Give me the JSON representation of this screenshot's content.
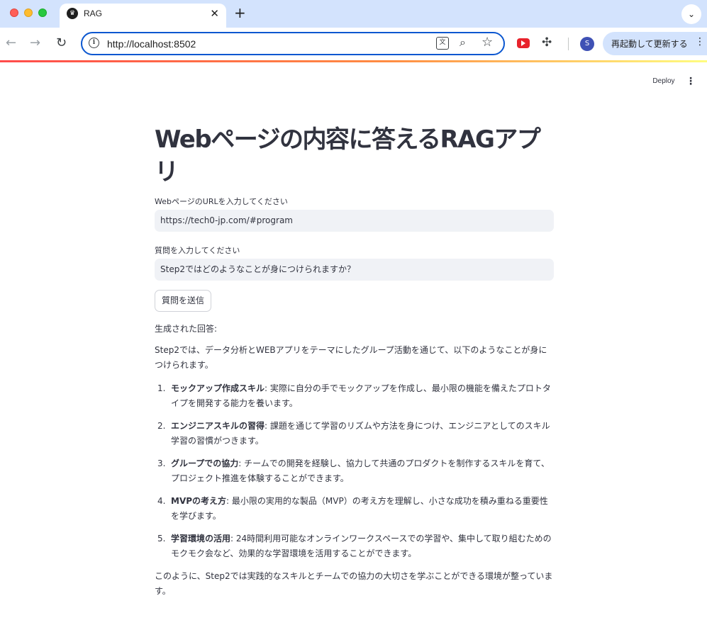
{
  "browser": {
    "tab_title": "RAG",
    "tab_close": "✕",
    "new_tab": "+",
    "url": "http://localhost:8502",
    "relaunch_label": "再起動して更新する",
    "profile_initial": "S",
    "icons": [
      "back-icon",
      "forward-icon",
      "reload-icon",
      "info-icon",
      "translate-icon",
      "zoom-icon",
      "star-icon",
      "youtube-extension-icon",
      "extensions-icon",
      "more-icon"
    ]
  },
  "app": {
    "deploy_label": "Deploy",
    "title": "Webページの内容に答えるRAGアプリ",
    "url_input": {
      "label": "WebページのURLを入力してください",
      "value": "https://tech0-jp.com/#program"
    },
    "question_input": {
      "label": "質問を入力してください",
      "value": "Step2ではどのようなことが身につけられますか？"
    },
    "submit_label": "質問を送信",
    "generated_heading": "生成された回答:",
    "answer": {
      "intro": "Step2では、データ分析とWEBアプリをテーマにしたグループ活動を通じて、以下のようなことが身につけられます。",
      "items": [
        {
          "num": "1.",
          "term": "モックアップ作成スキル",
          "text": ": 実際に自分の手でモックアップを作成し、最小限の機能を備えたプロトタイプを開発する能力を養います。"
        },
        {
          "num": "2.",
          "term": "エンジニアスキルの習得",
          "text": ": 課題を通じて学習のリズムや方法を身につけ、エンジニアとしてのスキル学習の習慣がつきます。"
        },
        {
          "num": "3.",
          "term": "グループでの協力",
          "text": ": チームでの開発を経験し、協力して共通のプロダクトを制作するスキルを育て、プロジェクト推進を体験することができます。"
        },
        {
          "num": "4.",
          "term": "MVPの考え方",
          "text": ": 最小限の実用的な製品（MVP）の考え方を理解し、小さな成功を積み重ねる重要性を学びます。"
        },
        {
          "num": "5.",
          "term": "学習環境の活用",
          "text": ": 24時間利用可能なオンラインワークスペースでの学習や、集中して取り組むためのモクモク会など、効果的な学習環境を活用することができます。"
        }
      ],
      "outro": "このように、Step2では実践的なスキルとチームでの協力の大切さを学ぶことができる環境が整っています。"
    }
  }
}
